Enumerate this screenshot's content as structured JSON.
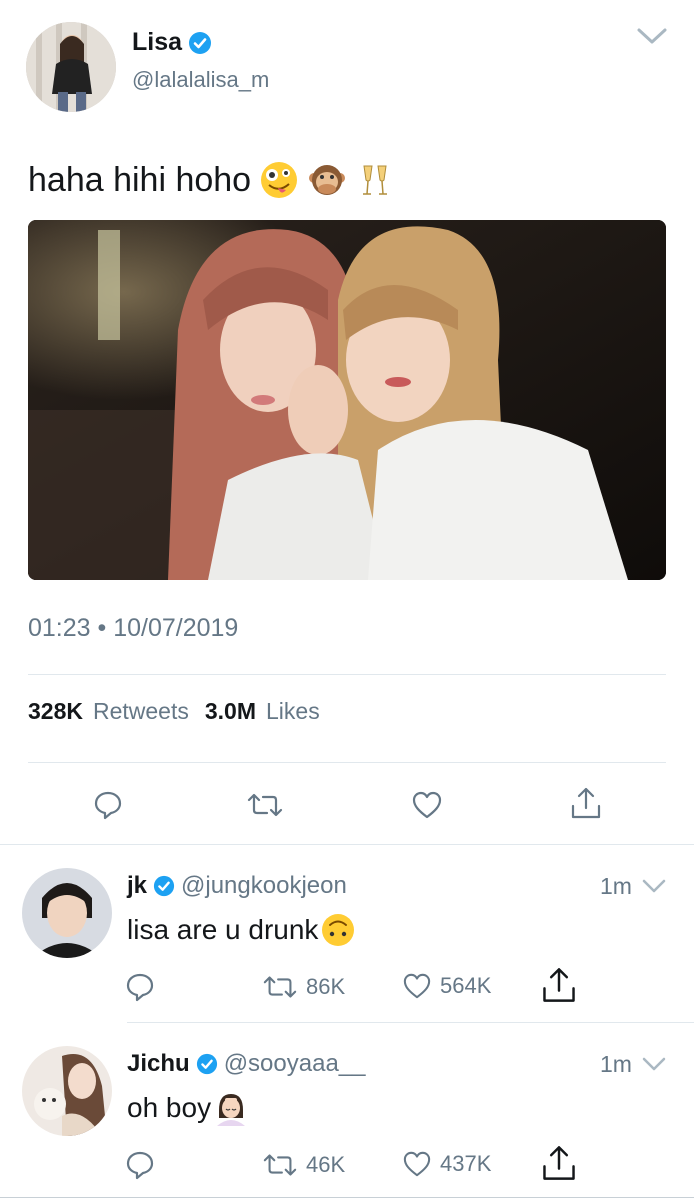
{
  "tweet": {
    "author_name": "Lisa",
    "author_handle": "@lalalalisa_m",
    "text": "haha hihi hoho",
    "emojis": [
      "zany-face",
      "speak-no-evil-monkey",
      "clinking-glasses"
    ],
    "timestamp": "01:23 • 10/07/2019",
    "retweet_count": "328K",
    "retweet_label": "Retweets",
    "like_count": "3.0M",
    "like_label": "Likes",
    "actions": [
      "reply-icon",
      "retweet-icon",
      "like-icon",
      "share-icon"
    ]
  },
  "replies": [
    {
      "name": "jk",
      "handle": "@jungkookjeon",
      "time": "1m",
      "text": "lisa are u drunk",
      "emoji": "upside-down-face",
      "retweets": "86K",
      "likes": "564K"
    },
    {
      "name": "Jichu",
      "handle": "@sooyaaa__",
      "time": "1m",
      "text": "oh boy",
      "emoji": "face-palm-woman",
      "retweets": "46K",
      "likes": "437K"
    }
  ],
  "colors": {
    "verified": "#1da1f2",
    "secondary_text": "#657786",
    "divider": "#e1e8ed"
  }
}
